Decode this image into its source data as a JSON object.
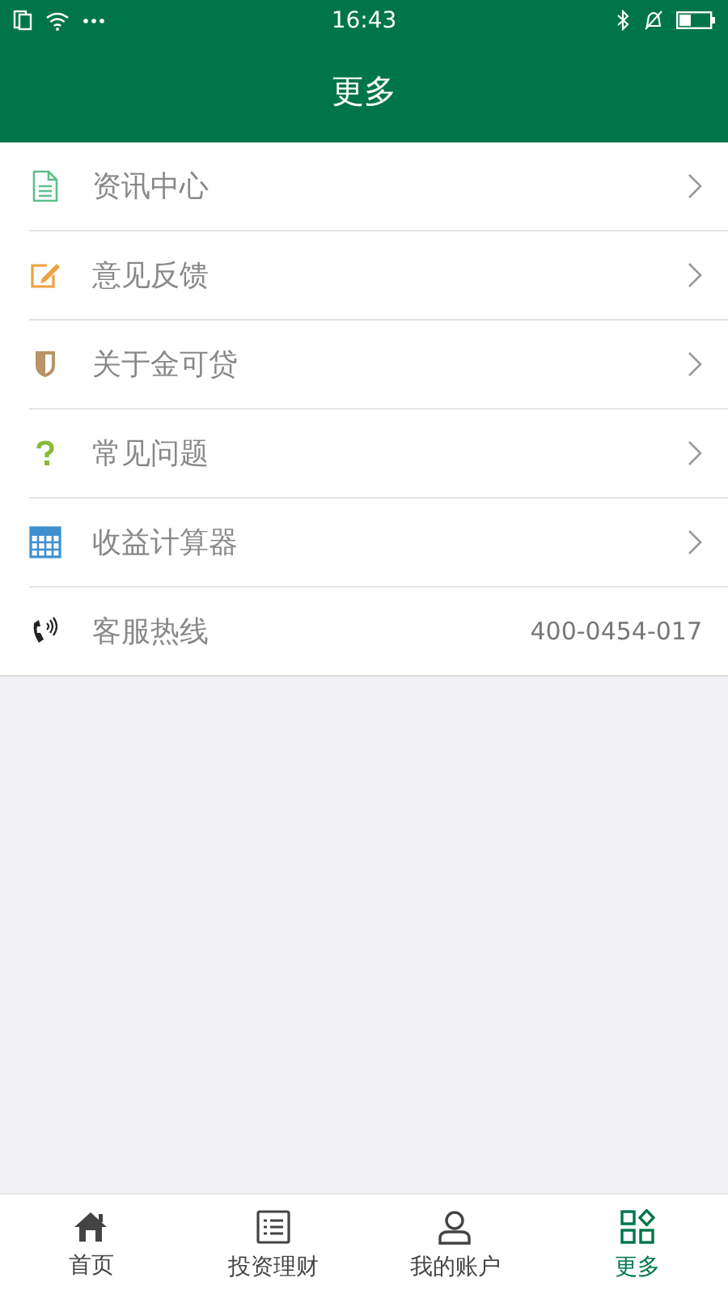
{
  "status_bar": {
    "time": "16:43"
  },
  "header": {
    "title": "更多"
  },
  "menu": [
    {
      "label": "资讯中心",
      "kind": "link"
    },
    {
      "label": "意见反馈",
      "kind": "link"
    },
    {
      "label": "关于金可贷",
      "kind": "link"
    },
    {
      "label": "常见问题",
      "kind": "link"
    },
    {
      "label": "收益计算器",
      "kind": "link"
    },
    {
      "label": "客服热线",
      "kind": "info",
      "value": "400-0454-017"
    }
  ],
  "tab_bar": [
    {
      "label": "首页",
      "selected": false
    },
    {
      "label": "投资理财",
      "selected": false
    },
    {
      "label": "我的账户",
      "selected": false
    },
    {
      "label": "更多",
      "selected": true
    }
  ]
}
